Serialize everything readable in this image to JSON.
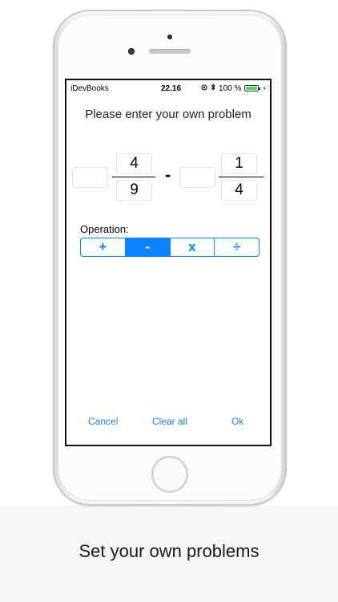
{
  "status_bar": {
    "carrier": "iDevBooks",
    "time": "22.16",
    "battery": "100 %",
    "battery_level": 1.0
  },
  "prompt": "Please enter your own problem",
  "fraction_left": {
    "whole": "",
    "numerator": "4",
    "denominator": "9"
  },
  "operator_symbol": "-",
  "fraction_right": {
    "whole": "",
    "numerator": "1",
    "denominator": "4"
  },
  "operation": {
    "label": "Operation:",
    "options": [
      "+",
      "-",
      "x",
      "÷"
    ],
    "selected": "-"
  },
  "buttons": {
    "cancel": "Cancel",
    "clear_all": "Clear all",
    "ok": "Ok"
  },
  "caption": "Set your own problems",
  "colors": {
    "accent": "#0a84ff",
    "battery": "#4cd964"
  },
  "icons": [
    "lock-rotation-icon",
    "bluetooth-icon",
    "battery-icon"
  ]
}
